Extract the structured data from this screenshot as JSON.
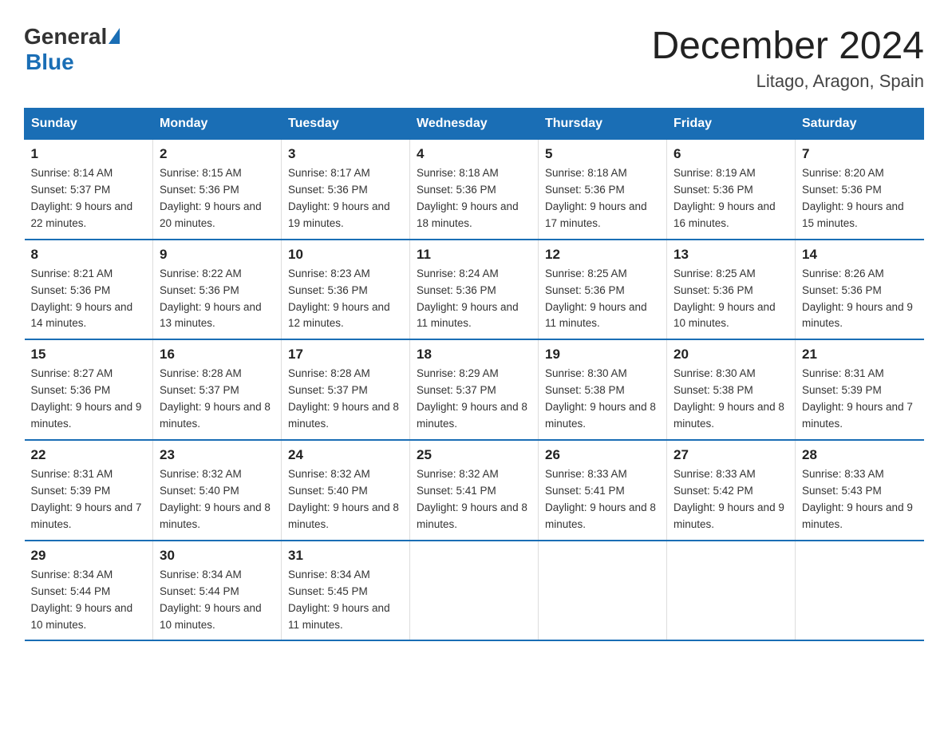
{
  "header": {
    "logo_general": "General",
    "logo_blue": "Blue",
    "title": "December 2024",
    "subtitle": "Litago, Aragon, Spain"
  },
  "days_of_week": [
    "Sunday",
    "Monday",
    "Tuesday",
    "Wednesday",
    "Thursday",
    "Friday",
    "Saturday"
  ],
  "weeks": [
    [
      {
        "day": "1",
        "sunrise": "8:14 AM",
        "sunset": "5:37 PM",
        "daylight": "9 hours and 22 minutes."
      },
      {
        "day": "2",
        "sunrise": "8:15 AM",
        "sunset": "5:36 PM",
        "daylight": "9 hours and 20 minutes."
      },
      {
        "day": "3",
        "sunrise": "8:17 AM",
        "sunset": "5:36 PM",
        "daylight": "9 hours and 19 minutes."
      },
      {
        "day": "4",
        "sunrise": "8:18 AM",
        "sunset": "5:36 PM",
        "daylight": "9 hours and 18 minutes."
      },
      {
        "day": "5",
        "sunrise": "8:18 AM",
        "sunset": "5:36 PM",
        "daylight": "9 hours and 17 minutes."
      },
      {
        "day": "6",
        "sunrise": "8:19 AM",
        "sunset": "5:36 PM",
        "daylight": "9 hours and 16 minutes."
      },
      {
        "day": "7",
        "sunrise": "8:20 AM",
        "sunset": "5:36 PM",
        "daylight": "9 hours and 15 minutes."
      }
    ],
    [
      {
        "day": "8",
        "sunrise": "8:21 AM",
        "sunset": "5:36 PM",
        "daylight": "9 hours and 14 minutes."
      },
      {
        "day": "9",
        "sunrise": "8:22 AM",
        "sunset": "5:36 PM",
        "daylight": "9 hours and 13 minutes."
      },
      {
        "day": "10",
        "sunrise": "8:23 AM",
        "sunset": "5:36 PM",
        "daylight": "9 hours and 12 minutes."
      },
      {
        "day": "11",
        "sunrise": "8:24 AM",
        "sunset": "5:36 PM",
        "daylight": "9 hours and 11 minutes."
      },
      {
        "day": "12",
        "sunrise": "8:25 AM",
        "sunset": "5:36 PM",
        "daylight": "9 hours and 11 minutes."
      },
      {
        "day": "13",
        "sunrise": "8:25 AM",
        "sunset": "5:36 PM",
        "daylight": "9 hours and 10 minutes."
      },
      {
        "day": "14",
        "sunrise": "8:26 AM",
        "sunset": "5:36 PM",
        "daylight": "9 hours and 9 minutes."
      }
    ],
    [
      {
        "day": "15",
        "sunrise": "8:27 AM",
        "sunset": "5:36 PM",
        "daylight": "9 hours and 9 minutes."
      },
      {
        "day": "16",
        "sunrise": "8:28 AM",
        "sunset": "5:37 PM",
        "daylight": "9 hours and 8 minutes."
      },
      {
        "day": "17",
        "sunrise": "8:28 AM",
        "sunset": "5:37 PM",
        "daylight": "9 hours and 8 minutes."
      },
      {
        "day": "18",
        "sunrise": "8:29 AM",
        "sunset": "5:37 PM",
        "daylight": "9 hours and 8 minutes."
      },
      {
        "day": "19",
        "sunrise": "8:30 AM",
        "sunset": "5:38 PM",
        "daylight": "9 hours and 8 minutes."
      },
      {
        "day": "20",
        "sunrise": "8:30 AM",
        "sunset": "5:38 PM",
        "daylight": "9 hours and 8 minutes."
      },
      {
        "day": "21",
        "sunrise": "8:31 AM",
        "sunset": "5:39 PM",
        "daylight": "9 hours and 7 minutes."
      }
    ],
    [
      {
        "day": "22",
        "sunrise": "8:31 AM",
        "sunset": "5:39 PM",
        "daylight": "9 hours and 7 minutes."
      },
      {
        "day": "23",
        "sunrise": "8:32 AM",
        "sunset": "5:40 PM",
        "daylight": "9 hours and 8 minutes."
      },
      {
        "day": "24",
        "sunrise": "8:32 AM",
        "sunset": "5:40 PM",
        "daylight": "9 hours and 8 minutes."
      },
      {
        "day": "25",
        "sunrise": "8:32 AM",
        "sunset": "5:41 PM",
        "daylight": "9 hours and 8 minutes."
      },
      {
        "day": "26",
        "sunrise": "8:33 AM",
        "sunset": "5:41 PM",
        "daylight": "9 hours and 8 minutes."
      },
      {
        "day": "27",
        "sunrise": "8:33 AM",
        "sunset": "5:42 PM",
        "daylight": "9 hours and 9 minutes."
      },
      {
        "day": "28",
        "sunrise": "8:33 AM",
        "sunset": "5:43 PM",
        "daylight": "9 hours and 9 minutes."
      }
    ],
    [
      {
        "day": "29",
        "sunrise": "8:34 AM",
        "sunset": "5:44 PM",
        "daylight": "9 hours and 10 minutes."
      },
      {
        "day": "30",
        "sunrise": "8:34 AM",
        "sunset": "5:44 PM",
        "daylight": "9 hours and 10 minutes."
      },
      {
        "day": "31",
        "sunrise": "8:34 AM",
        "sunset": "5:45 PM",
        "daylight": "9 hours and 11 minutes."
      },
      null,
      null,
      null,
      null
    ]
  ]
}
